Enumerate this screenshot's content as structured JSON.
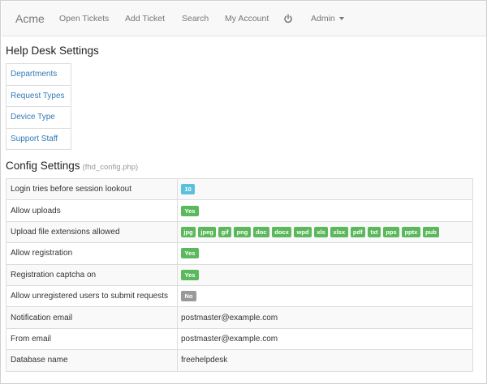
{
  "navbar": {
    "brand": "Acme",
    "items": [
      {
        "label": "Open Tickets"
      },
      {
        "label": "Add Ticket"
      },
      {
        "label": "Search"
      },
      {
        "label": "My Account"
      }
    ],
    "power_icon": "power-icon",
    "admin_label": "Admin"
  },
  "settings": {
    "title": "Help Desk Settings",
    "menu": [
      {
        "label": "Departments"
      },
      {
        "label": "Request Types"
      },
      {
        "label": "Device Type"
      },
      {
        "label": "Support Staff"
      }
    ]
  },
  "config": {
    "title": "Config Settings",
    "file": "(fhd_config.php)",
    "rows": {
      "login_tries": {
        "label": "Login tries before session lookout",
        "value": "10"
      },
      "allow_uploads": {
        "label": "Allow uploads",
        "value": "Yes"
      },
      "extensions": {
        "label": "Upload file extensions allowed",
        "values": [
          "jpg",
          "jpeg",
          "gif",
          "png",
          "doc",
          "docx",
          "wpd",
          "xls",
          "xlsx",
          "pdf",
          "txt",
          "pps",
          "pptx",
          "pub"
        ]
      },
      "allow_registration": {
        "label": "Allow registration",
        "value": "Yes"
      },
      "captcha": {
        "label": "Registration captcha on",
        "value": "Yes"
      },
      "unregistered": {
        "label": "Allow unregistered users to submit requests",
        "value": "No"
      },
      "notification_email": {
        "label": "Notification email",
        "value": "postmaster@example.com"
      },
      "from_email": {
        "label": "From email",
        "value": "postmaster@example.com"
      },
      "db_name": {
        "label": "Database name",
        "value": "freehelpdesk"
      }
    }
  },
  "colors": {
    "badge_info": "#5bc0de",
    "badge_success": "#5cb85c",
    "badge_default": "#999999",
    "link": "#337ab7"
  }
}
